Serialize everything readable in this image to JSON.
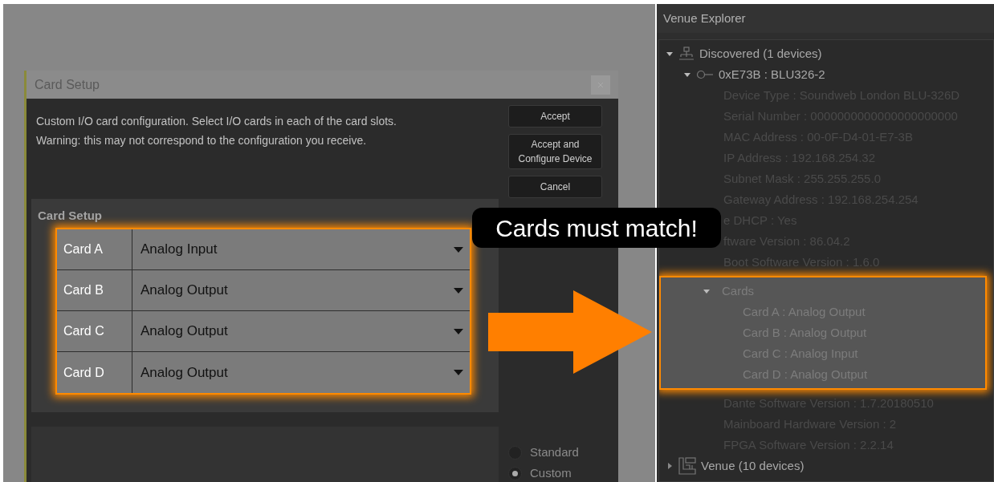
{
  "dialog": {
    "title": "Card Setup",
    "message": [
      "Custom I/O card configuration. Select I/O cards in each of the card slots.",
      "Warning: this may not correspond to the configuration you receive."
    ],
    "buttons": [
      "Accept",
      "Accept and Configure Device",
      "Cancel"
    ],
    "section_title": "Card Setup",
    "cards_highlighted": true,
    "cards": [
      {
        "slot": "Card A",
        "value": "Analog Input"
      },
      {
        "slot": "Card B",
        "value": "Analog Output"
      },
      {
        "slot": "Card C",
        "value": "Analog Output"
      },
      {
        "slot": "Card D",
        "value": "Analog Output"
      }
    ],
    "modes": [
      {
        "label": "Standard",
        "selected": false
      },
      {
        "label": "Custom",
        "selected": true
      }
    ]
  },
  "callout": {
    "text": "Cards must match!"
  },
  "venue_explorer": {
    "title": "Venue Explorer",
    "tree": [
      {
        "label": "Discovered (1 devices)",
        "kind": "network",
        "expanded": true,
        "children": [
          {
            "label": "0xE73B : BLU326-2",
            "kind": "device",
            "expanded": true,
            "children": [
              {
                "label": "Device Type : Soundweb London BLU-326D",
                "kind": "property"
              },
              {
                "label": "Serial Number : 0000000000000000000000",
                "kind": "property"
              },
              {
                "label": "MAC Address : 00-0F-D4-01-E7-3B",
                "kind": "property"
              },
              {
                "label": "IP Address : 192.168.254.32",
                "kind": "property"
              },
              {
                "label": "Subnet Mask : 255.255.255.0",
                "kind": "property"
              },
              {
                "label": "Gateway Address : 192.168.254.254",
                "kind": "property"
              },
              {
                "label": "e DHCP : Yes",
                "kind": "property"
              },
              {
                "label": "ftware Version : 86.04.2",
                "kind": "property"
              },
              {
                "label": "Boot Software Version : 1.6.0",
                "kind": "property"
              },
              {
                "label": "Cards",
                "kind": "group",
                "expanded": true,
                "highlighted": true,
                "children": [
                  {
                    "label": "Card A : Analog Output",
                    "kind": "property"
                  },
                  {
                    "label": "Card B : Analog Output",
                    "kind": "property"
                  },
                  {
                    "label": "Card C : Analog Input",
                    "kind": "property"
                  },
                  {
                    "label": "Card D : Analog Output",
                    "kind": "property"
                  }
                ]
              },
              {
                "label": "Dante Software Version : 1.7.20180510",
                "kind": "property"
              },
              {
                "label": "Mainboard Hardware Version : 2",
                "kind": "property"
              },
              {
                "label": "FPGA Software Version : 2.2.14",
                "kind": "property"
              }
            ]
          }
        ]
      },
      {
        "label": "Venue (10 devices)",
        "kind": "venue",
        "expanded": false
      }
    ]
  }
}
